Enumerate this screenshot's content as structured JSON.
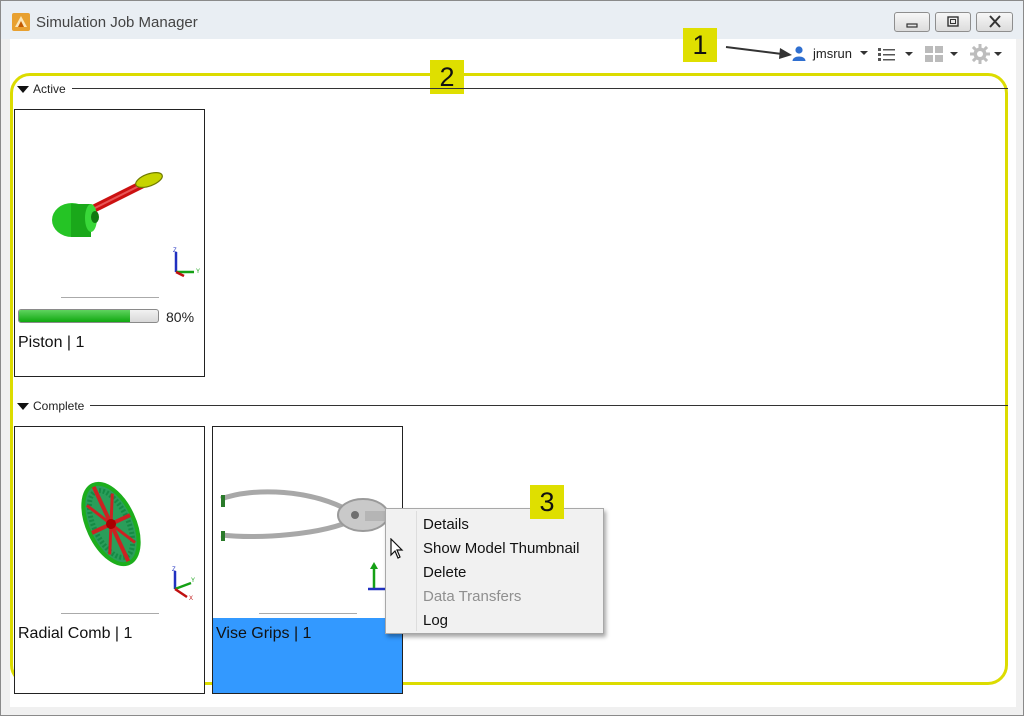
{
  "window": {
    "title": "Simulation Job Manager",
    "buttons": [
      "minimize",
      "restore",
      "close"
    ]
  },
  "toolbar": {
    "user": "jmsrun",
    "icons": [
      "user-icon",
      "list-view-icon",
      "layout-icon",
      "gear-icon"
    ]
  },
  "callouts": [
    "1",
    "2",
    "3"
  ],
  "sections": {
    "active": {
      "label": "Active",
      "jobs": [
        {
          "label": "Piston | 1",
          "progress_text": "80%",
          "progress": 0.8
        }
      ]
    },
    "complete": {
      "label": "Complete",
      "jobs": [
        {
          "label": "Radial Comb | 1"
        },
        {
          "label": "Vise Grips | 1",
          "selected": true
        }
      ]
    }
  },
  "context_menu": {
    "items": [
      {
        "label": "Details",
        "enabled": true
      },
      {
        "label": "Show Model Thumbnail",
        "enabled": true
      },
      {
        "label": "Delete",
        "enabled": true
      },
      {
        "label": "Data Transfers",
        "enabled": false
      },
      {
        "label": "Log",
        "enabled": true
      }
    ]
  },
  "colors": {
    "selection": "#3399ff",
    "callout": "#dfdf00",
    "progress": "#10a810"
  }
}
